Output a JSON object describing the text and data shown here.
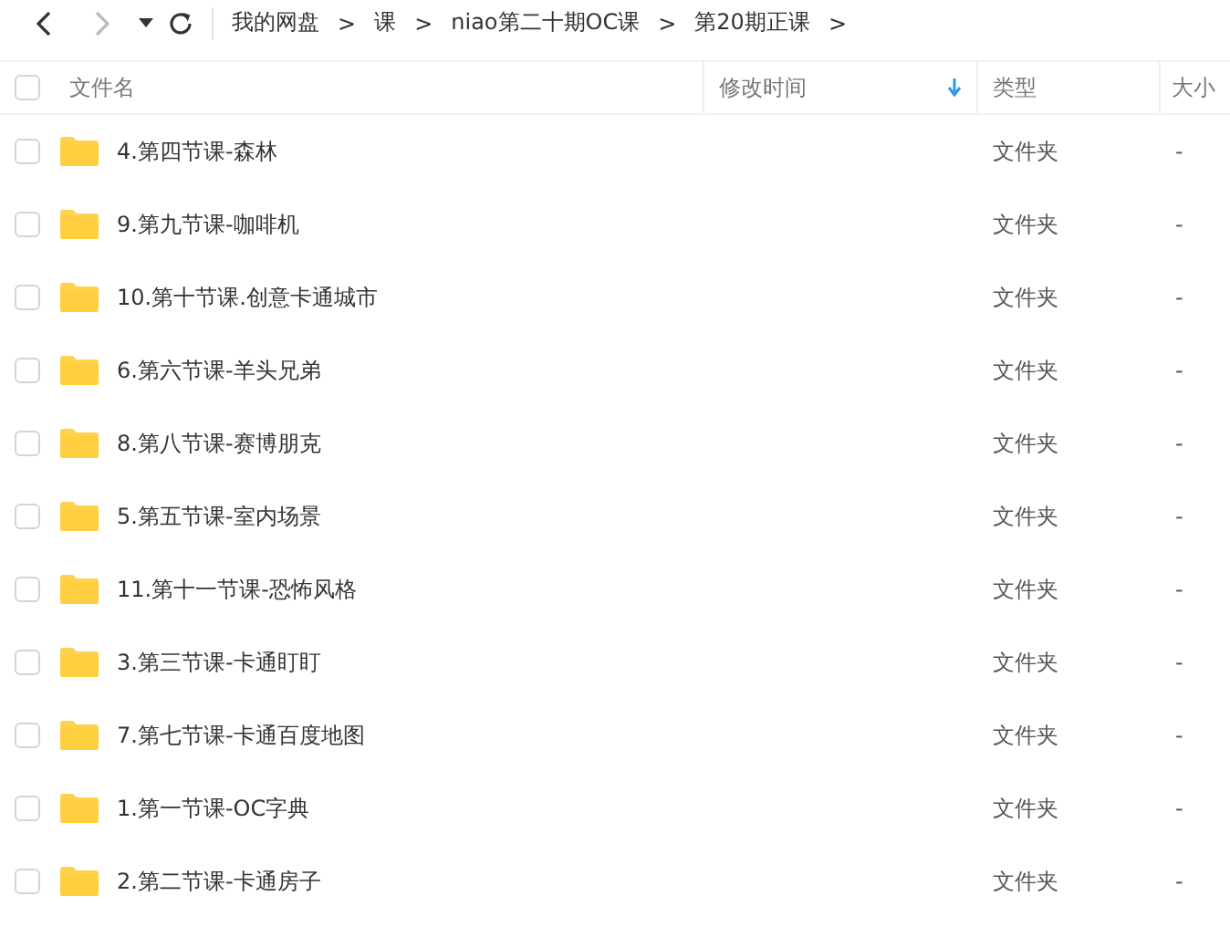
{
  "nav": {
    "back": {
      "disabled": false
    },
    "forward": {
      "disabled": true
    }
  },
  "breadcrumbs": [
    {
      "label": "我的网盘",
      "separator": ">"
    },
    {
      "label": "课",
      "separator": ">"
    },
    {
      "label": "niao第二十期OC课",
      "separator": ">"
    },
    {
      "label": "第20期正课",
      "separator": ">"
    }
  ],
  "table": {
    "select_all": {
      "checked": false
    },
    "columns": [
      {
        "label": "文件名",
        "sorted": false
      },
      {
        "label": "修改时间",
        "sorted": true
      },
      {
        "label": "类型",
        "sorted": false
      },
      {
        "label": "大小",
        "sorted": false
      }
    ],
    "rows": [
      {
        "name": "4.第四节课-森林",
        "type": "文件夹",
        "size": "-",
        "checked": false
      },
      {
        "name": "9.第九节课-咖啡机",
        "type": "文件夹",
        "size": "-",
        "checked": false
      },
      {
        "name": "10.第十节课.创意卡通城市",
        "type": "文件夹",
        "size": "-",
        "checked": false
      },
      {
        "name": "6.第六节课-羊头兄弟",
        "type": "文件夹",
        "size": "-",
        "checked": false
      },
      {
        "name": "8.第八节课-赛博朋克",
        "type": "文件夹",
        "size": "-",
        "checked": false
      },
      {
        "name": "5.第五节课-室内场景",
        "type": "文件夹",
        "size": "-",
        "checked": false
      },
      {
        "name": "11.第十一节课-恐怖风格",
        "type": "文件夹",
        "size": "-",
        "checked": false
      },
      {
        "name": "3.第三节课-卡通盯盯",
        "type": "文件夹",
        "size": "-",
        "checked": false
      },
      {
        "name": "7.第七节课-卡通百度地图",
        "type": "文件夹",
        "size": "-",
        "checked": false
      },
      {
        "name": "1.第一节课-OC字典",
        "type": "文件夹",
        "size": "-",
        "checked": false
      },
      {
        "name": "2.第二节课-卡通房子",
        "type": "文件夹",
        "size": "-",
        "checked": false
      }
    ]
  }
}
